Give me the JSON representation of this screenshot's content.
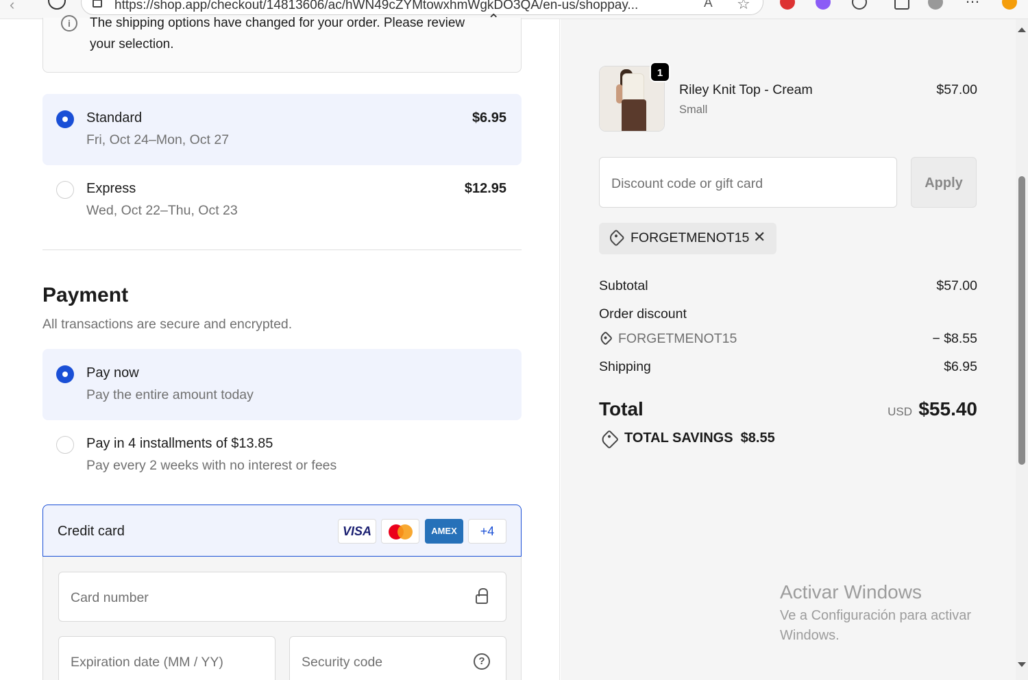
{
  "browser": {
    "url": "https://shop.app/checkout/14813606/ac/hWN49cZYMtowxhmWgkDO3QA/en-us/shoppay..."
  },
  "notice": {
    "message": "The shipping options have changed for your order. Please review your selection."
  },
  "shipping": {
    "options": [
      {
        "name": "Standard",
        "dates": "Fri, Oct 24–Mon, Oct 27",
        "price": "$6.95",
        "selected": true
      },
      {
        "name": "Express",
        "dates": "Wed, Oct 22–Thu, Oct 23",
        "price": "$12.95",
        "selected": false
      }
    ]
  },
  "payment": {
    "title": "Payment",
    "subtitle": "All transactions are secure and encrypted.",
    "options": [
      {
        "title": "Pay now",
        "subtitle": "Pay the entire amount today",
        "selected": true
      },
      {
        "title": "Pay in 4 installments of $13.85",
        "subtitle": "Pay every 2 weeks with no interest or fees",
        "selected": false
      }
    ],
    "credit_card": {
      "label": "Credit card",
      "brands": [
        "VISA",
        "AMEX"
      ],
      "more": "+4",
      "card_number_placeholder": "Card number",
      "expiration_placeholder": "Expiration date (MM / YY)",
      "security_code_placeholder": "Security code"
    }
  },
  "order": {
    "product": {
      "name": "Riley Knit Top - Cream",
      "variant": "Small",
      "price": "$57.00",
      "quantity": "1"
    },
    "discount_placeholder": "Discount code or gift card",
    "apply_label": "Apply",
    "applied_code": "FORGETMENOT15",
    "summary": {
      "subtotal_label": "Subtotal",
      "subtotal": "$57.00",
      "discount_label": "Order discount",
      "discount_code": "FORGETMENOT15",
      "discount_amount": "− $8.55",
      "shipping_label": "Shipping",
      "shipping": "$6.95",
      "total_label": "Total",
      "currency": "USD",
      "total": "$55.40",
      "savings_label": "TOTAL SAVINGS",
      "savings": "$8.55"
    }
  },
  "watermark": {
    "title": "Activar Windows",
    "subtitle": "Ve a Configuración para activar Windows."
  },
  "colors": {
    "accent": "#1a4fd6",
    "selected_bg": "#f0f3fd",
    "sidebar_bg": "#f5f5f5"
  }
}
